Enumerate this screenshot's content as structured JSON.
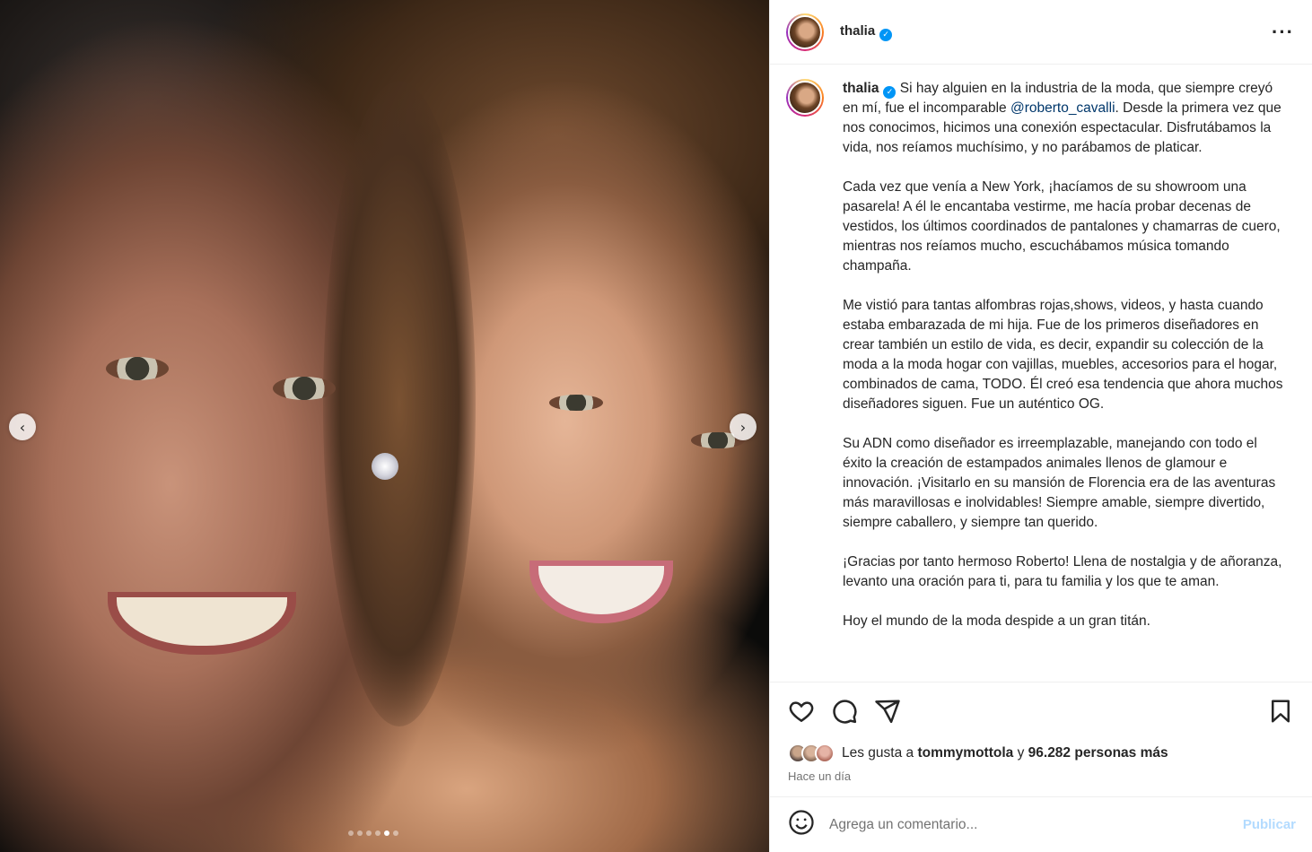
{
  "post": {
    "username": "thalia",
    "verified_icon": "verified-badge-icon",
    "more_icon": "more-options-icon"
  },
  "media": {
    "nav_prev_icon": "chevron-left-icon",
    "nav_next_icon": "chevron-right-icon",
    "carousel_dots": 6,
    "carousel_active_index": 4
  },
  "caption": {
    "username": "thalia",
    "p1_before": "Si hay alguien en la industria de la moda, que siempre creyó en mí, fue el incomparable ",
    "p1_mention": "@roberto_cavalli",
    "p1_after": ". Desde la primera vez que nos conocimos, hicimos una conexión espectacular. Disfrutábamos la vida, nos reíamos muchísimo, y no parábamos de platicar.",
    "p2": "Cada vez que venía a New York, ¡hacíamos de su showroom una pasarela! A él le encantaba vestirme, me hacía probar decenas de vestidos, los últimos coordinados de pantalones y chamarras de cuero, mientras nos reíamos mucho, escuchábamos música tomando champaña.",
    "p3": "Me vistió para tantas alfombras rojas,shows, videos, y hasta cuando estaba embarazada de mi hija. Fue de los primeros diseñadores en crear también un estilo de vida, es decir, expandir su colección de la moda a la moda hogar con vajillas, muebles, accesorios para el hogar, combinados de cama, TODO. Él creó esa tendencia que ahora muchos diseñadores siguen. Fue un auténtico OG.",
    "p4": "Su ADN como diseñador es irreemplazable, manejando con todo el éxito la creación de estampados animales llenos de glamour e innovación. ¡Visitarlo en su mansión de Florencia era de las aventuras más maravillosas e inolvidables! Siempre amable, siempre divertido, siempre caballero, y siempre tan querido.",
    "p5": "¡Gracias por tanto hermoso Roberto! Llena de nostalgia y de añoranza, levanto una oración para ti, para tu familia y los que te aman.",
    "p6": "Hoy el mundo de la moda despide a un gran titán."
  },
  "actions": {
    "like_icon": "heart-icon",
    "comment_icon": "comment-icon",
    "share_icon": "share-icon",
    "save_icon": "bookmark-icon"
  },
  "likes": {
    "prefix": "Les gusta a ",
    "user": "tommymottola",
    "middle": " y ",
    "count": "96.282 personas más"
  },
  "timestamp": "Hace un día",
  "comment": {
    "emoji_icon": "emoji-icon",
    "placeholder": "Agrega un comentario...",
    "publish_label": "Publicar"
  },
  "colors": {
    "verified": "#0095f6",
    "mention": "#00376b",
    "publish_disabled": "#b3dbff",
    "secondary_text": "#737373"
  }
}
